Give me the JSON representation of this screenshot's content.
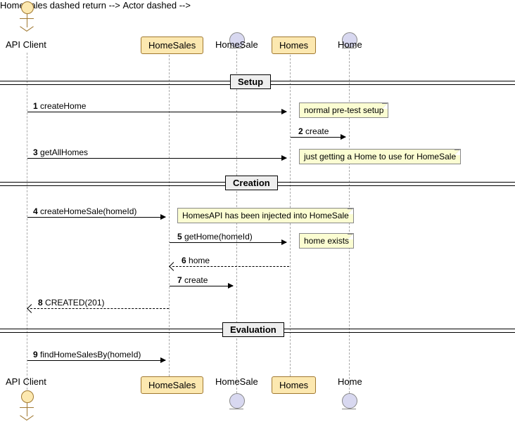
{
  "participants": {
    "actor": "API Client",
    "homesales": "HomeSales",
    "homesale": "HomeSale",
    "homes": "Homes",
    "home": "Home"
  },
  "dividers": {
    "setup": "Setup",
    "creation": "Creation",
    "evaluation": "Evaluation"
  },
  "messages": {
    "m1": {
      "num": "1",
      "text": "createHome"
    },
    "m2": {
      "num": "2",
      "text": "create"
    },
    "m3": {
      "num": "3",
      "text": "getAllHomes"
    },
    "m4": {
      "num": "4",
      "text": "createHomeSale(homeId)"
    },
    "m5": {
      "num": "5",
      "text": "getHome(homeId)"
    },
    "m6": {
      "num": "6",
      "text": "home"
    },
    "m7": {
      "num": "7",
      "text": "create"
    },
    "m8": {
      "num": "8",
      "text": "CREATED(201)"
    },
    "m9": {
      "num": "9",
      "text": "findHomeSalesBy(homeId)"
    }
  },
  "notes": {
    "n1": "normal pre-test setup",
    "n2": "just getting a Home to use for HomeSale",
    "n3": "HomesAPI has been injected into HomeSale",
    "n4": "home exists"
  }
}
